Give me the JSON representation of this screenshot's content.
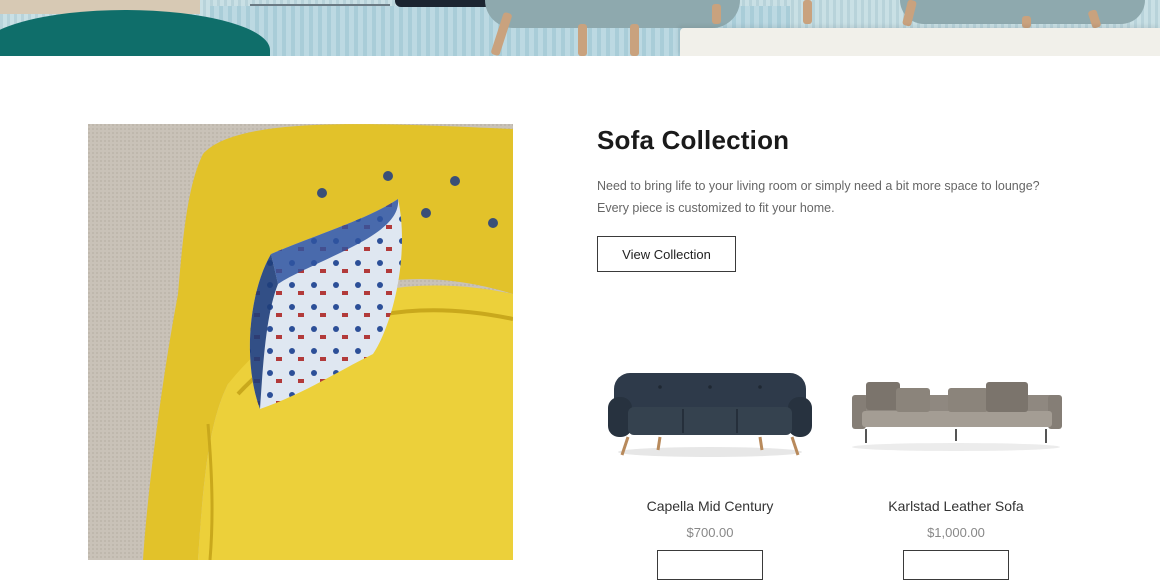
{
  "collection": {
    "title": "Sofa Collection",
    "description": "Need to bring life to your living room or simply need a bit more space to lounge? Every piece is customized to fit your home.",
    "view_button_label": "View Collection"
  },
  "products": [
    {
      "name": "Capella Mid Century",
      "price": "$700.00",
      "image_icon": "dark-navy-sofa"
    },
    {
      "name": "Karlstad Leather Sofa",
      "price": "$1,000.00",
      "image_icon": "grey-leather-sofa"
    }
  ],
  "colors": {
    "armchair_yellow": "#e9cc2f",
    "navy_sofa": "#2e3a4a",
    "grey_sofa": "#9a948c",
    "chair_teal": "#8ea9ae"
  }
}
